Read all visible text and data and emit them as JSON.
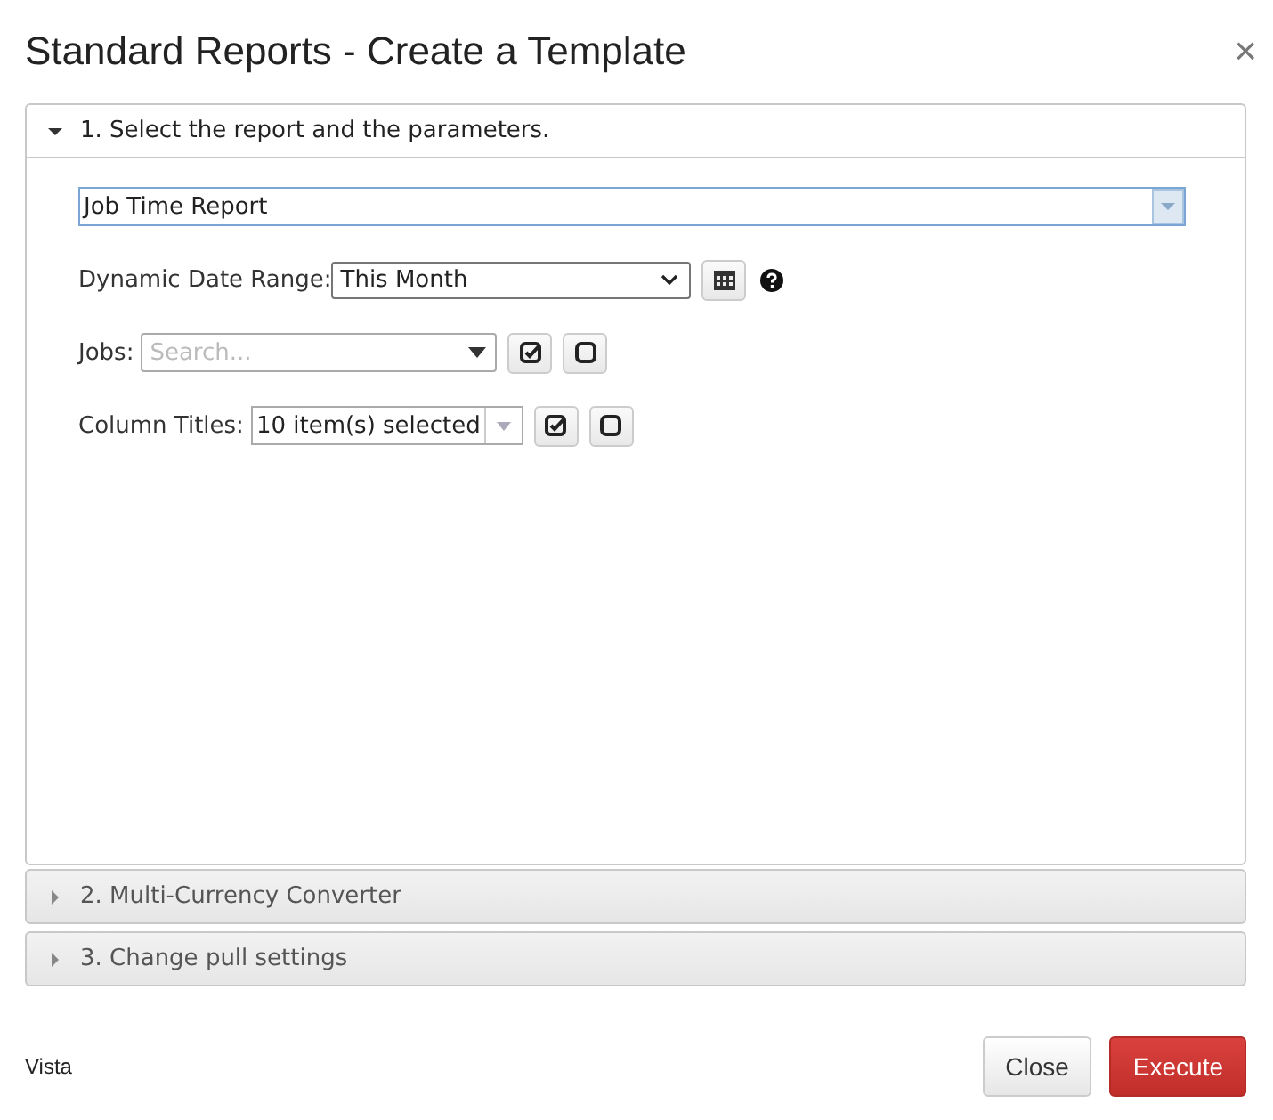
{
  "dialog": {
    "title": "Standard Reports - Create a Template",
    "close_icon": "×"
  },
  "sections": [
    {
      "title": "1. Select the report and the parameters.",
      "expanded": true
    },
    {
      "title": "2. Multi-Currency Converter",
      "expanded": false
    },
    {
      "title": "3. Change pull settings",
      "expanded": false
    }
  ],
  "report": {
    "value": "Job Time Report"
  },
  "fields": [
    {
      "kind": "date",
      "label": "Dynamic Date Range:",
      "value": "This Month"
    },
    {
      "kind": "search",
      "label": "Jobs:",
      "placeholder": "Search..."
    },
    {
      "kind": "multi",
      "label": "Column Titles:",
      "value": "10 item(s) selected"
    }
  ],
  "footer": {
    "label": "Vista",
    "buttons": [
      {
        "label": "Close",
        "kind": "default"
      },
      {
        "label": "Execute",
        "kind": "danger"
      }
    ]
  }
}
